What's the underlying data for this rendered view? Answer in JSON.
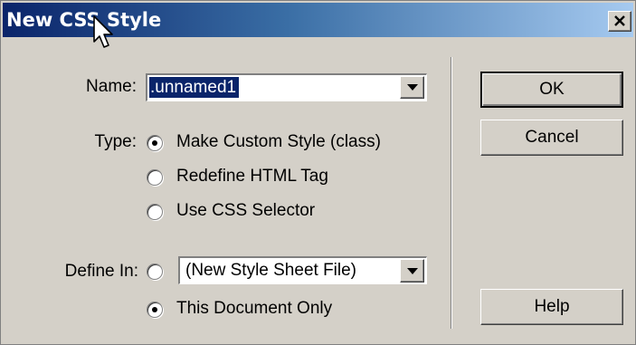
{
  "window": {
    "title": "New CSS Style",
    "close_icon": "close-x-icon"
  },
  "name": {
    "label": "Name:",
    "value": ".unnamed1"
  },
  "type": {
    "label": "Type:",
    "options": [
      {
        "label": "Make Custom Style (class)",
        "selected": true
      },
      {
        "label": "Redefine HTML Tag",
        "selected": false
      },
      {
        "label": "Use CSS Selector",
        "selected": false
      }
    ]
  },
  "define_in": {
    "label": "Define In:",
    "options": [
      {
        "label": "(New Style Sheet File)",
        "selected": false
      },
      {
        "label": "This Document Only",
        "selected": true
      }
    ]
  },
  "buttons": {
    "ok": "OK",
    "cancel": "Cancel",
    "help": "Help"
  },
  "colors": {
    "title_bar": "#0a246a",
    "dialog_bg": "#d4d0c8",
    "selection": "#0a246a"
  }
}
